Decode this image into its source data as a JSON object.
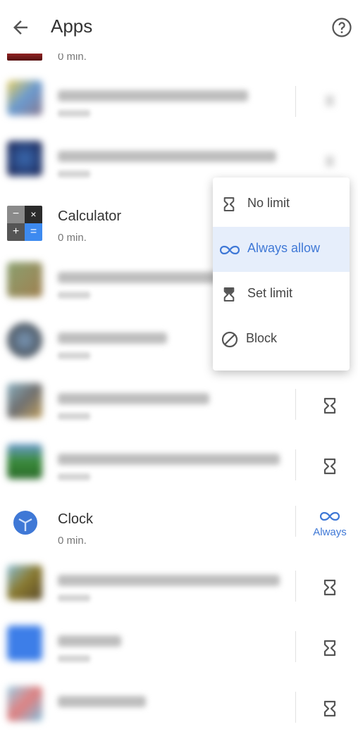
{
  "header": {
    "title": "Apps",
    "back_icon": "arrow-back-icon",
    "help_icon": "help-circle-icon"
  },
  "colors": {
    "accent": "#3f78d6",
    "selected_bg": "#e6eefb",
    "text": "#333333",
    "subtext": "#777777"
  },
  "apps": [
    {
      "name": "",
      "usage": "0 min.",
      "blurred": false,
      "partial": true,
      "action": ""
    },
    {
      "name": "[blurred app name]",
      "usage": "",
      "blurred": true,
      "action": "timer"
    },
    {
      "name": "[blurred app name]",
      "usage": "",
      "blurred": true,
      "action": "timer"
    },
    {
      "name": "Calculator",
      "usage": "0 min.",
      "blurred": false,
      "action": "menu-open"
    },
    {
      "name": "[blurred app name]",
      "usage": "",
      "blurred": true,
      "action": ""
    },
    {
      "name": "[blurred app name]",
      "usage": "",
      "blurred": true,
      "action": ""
    },
    {
      "name": "[blurred app name]",
      "usage": "",
      "blurred": true,
      "action": "timer"
    },
    {
      "name": "[blurred app name]",
      "usage": "",
      "blurred": true,
      "action": "timer"
    },
    {
      "name": "Clock",
      "usage": "0 min.",
      "blurred": false,
      "action": "always",
      "action_label": "Always"
    },
    {
      "name": "[blurred app name]",
      "usage": "",
      "blurred": true,
      "action": "timer"
    },
    {
      "name": "[blurred app name]",
      "usage": "",
      "blurred": true,
      "action": "timer"
    },
    {
      "name": "[blurred app name]",
      "usage": "",
      "blurred": true,
      "action": "timer"
    }
  ],
  "menu": {
    "items": [
      {
        "label": "No limit",
        "icon": "hourglass-empty-icon",
        "selected": false
      },
      {
        "label": "Always allow",
        "icon": "infinity-icon",
        "selected": true
      },
      {
        "label": "Set limit",
        "icon": "hourglass-icon",
        "selected": false
      },
      {
        "label": "Block",
        "icon": "block-icon",
        "selected": false
      }
    ]
  }
}
